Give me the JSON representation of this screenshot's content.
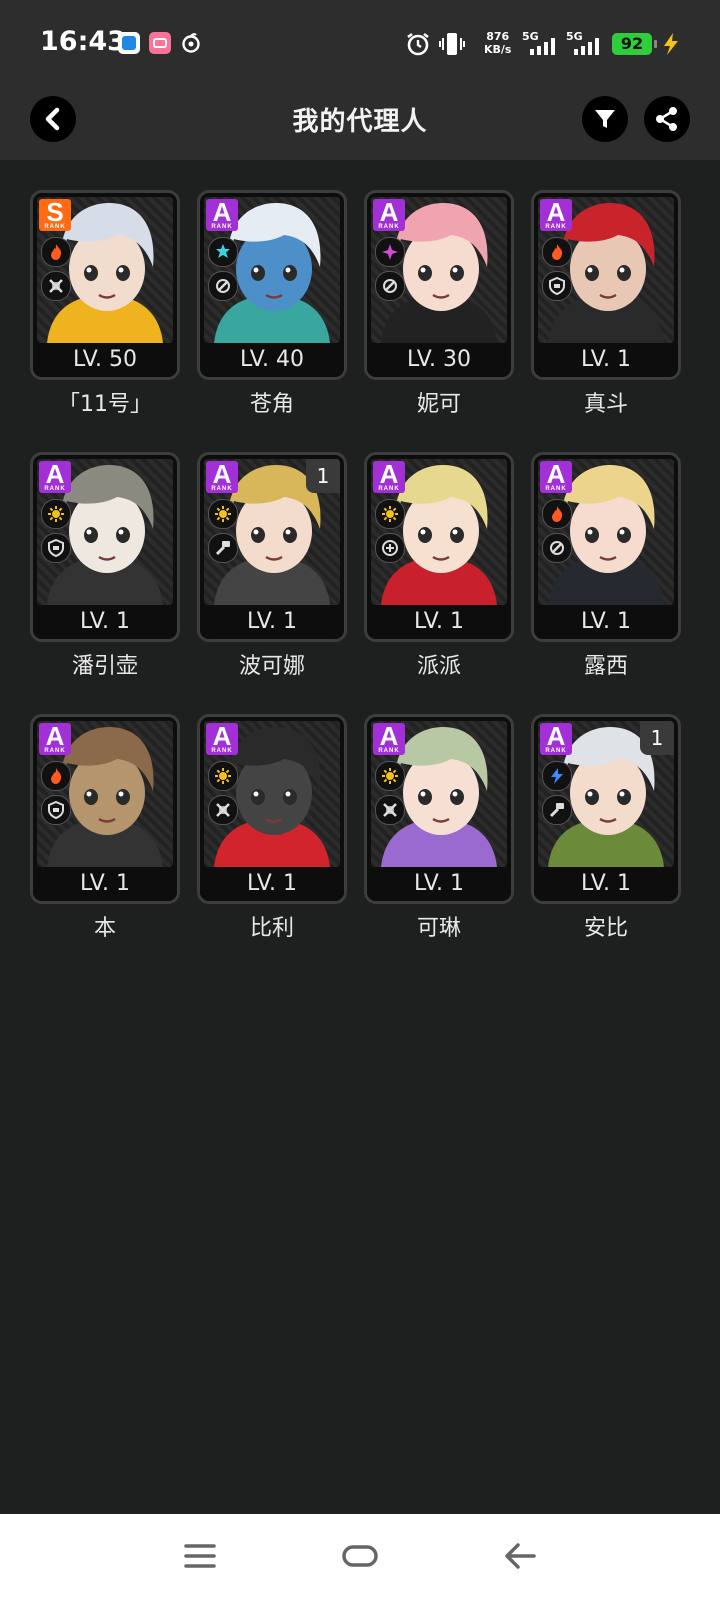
{
  "status_bar": {
    "time": "16:43",
    "net_speed_value": "876",
    "net_speed_unit": "KB/s",
    "signal_1": "5G",
    "signal_2": "5G",
    "battery": "92",
    "icons": [
      "app-icon-blue",
      "bilibili-icon",
      "netease-music-icon",
      "alarm-icon",
      "vibrate-icon",
      "charging-bolt-icon"
    ]
  },
  "header": {
    "title": "我的代理人",
    "back_icon": "chevron-left-icon",
    "filter_icon": "filter-funnel-icon",
    "share_icon": "share-icon"
  },
  "agents": [
    {
      "name": "「11号」",
      "level": "LV. 50",
      "rank": "S",
      "rank_sub": "RANK",
      "attribute": "fire",
      "specialty": "attack",
      "dupe": "",
      "theme": {
        "hair": "#d6dde8",
        "skin": "#f2dccd",
        "accent": "#f0b320"
      }
    },
    {
      "name": "苍角",
      "level": "LV. 40",
      "rank": "A",
      "rank_sub": "RANK",
      "attribute": "ice",
      "specialty": "support",
      "dupe": "",
      "theme": {
        "hair": "#e6ecf4",
        "skin": "#4d8fc8",
        "accent": "#3aa6a0"
      }
    },
    {
      "name": "妮可",
      "level": "LV. 30",
      "rank": "A",
      "rank_sub": "RANK",
      "attribute": "ether",
      "specialty": "support",
      "dupe": "",
      "theme": {
        "hair": "#f0a4b0",
        "skin": "#f6dccf",
        "accent": "#222"
      }
    },
    {
      "name": "真斗",
      "level": "LV. 1",
      "rank": "A",
      "rank_sub": "RANK",
      "attribute": "fire",
      "specialty": "defense",
      "dupe": "",
      "theme": {
        "hair": "#c9242c",
        "skin": "#e8c8b4",
        "accent": "#2a2a2a"
      }
    },
    {
      "name": "潘引壶",
      "level": "LV. 1",
      "rank": "A",
      "rank_sub": "RANK",
      "attribute": "physical",
      "specialty": "defense",
      "dupe": "",
      "theme": {
        "hair": "#8a8a80",
        "skin": "#efe8e0",
        "accent": "#333"
      }
    },
    {
      "name": "波可娜",
      "level": "LV. 1",
      "rank": "A",
      "rank_sub": "RANK",
      "attribute": "physical",
      "specialty": "stun",
      "dupe": "1",
      "theme": {
        "hair": "#d8b65a",
        "skin": "#f4dccc",
        "accent": "#444"
      }
    },
    {
      "name": "派派",
      "level": "LV. 1",
      "rank": "A",
      "rank_sub": "RANK",
      "attribute": "physical",
      "specialty": "anomaly",
      "dupe": "",
      "theme": {
        "hair": "#e6d88e",
        "skin": "#f6e0d0",
        "accent": "#c8202c"
      }
    },
    {
      "name": "露西",
      "level": "LV. 1",
      "rank": "A",
      "rank_sub": "RANK",
      "attribute": "fire",
      "specialty": "support",
      "dupe": "",
      "theme": {
        "hair": "#ecd48c",
        "skin": "#f6dccf",
        "accent": "#262a30"
      }
    },
    {
      "name": "本",
      "level": "LV. 1",
      "rank": "A",
      "rank_sub": "RANK",
      "attribute": "fire",
      "specialty": "defense",
      "dupe": "",
      "theme": {
        "hair": "#8a6a4a",
        "skin": "#b5956e",
        "accent": "#333"
      }
    },
    {
      "name": "比利",
      "level": "LV. 1",
      "rank": "A",
      "rank_sub": "RANK",
      "attribute": "physical",
      "specialty": "attack",
      "dupe": "",
      "theme": {
        "hair": "#2a2a2a",
        "skin": "#444",
        "accent": "#d2242c"
      }
    },
    {
      "name": "可琳",
      "level": "LV. 1",
      "rank": "A",
      "rank_sub": "RANK",
      "attribute": "physical",
      "specialty": "attack",
      "dupe": "",
      "theme": {
        "hair": "#b8c8a4",
        "skin": "#f6e0d4",
        "accent": "#9a6ad0"
      }
    },
    {
      "name": "安比",
      "level": "LV. 1",
      "rank": "A",
      "rank_sub": "RANK",
      "attribute": "electric",
      "specialty": "stun",
      "dupe": "1",
      "theme": {
        "hair": "#dfe2e6",
        "skin": "#f4dccc",
        "accent": "#6b8a3a"
      }
    }
  ],
  "attribute_colors": {
    "fire": "#ff5a1f",
    "ice": "#38d6e8",
    "ether": "#d24bd8",
    "physical": "#f2c21a",
    "electric": "#3a8cff"
  },
  "nav_bar": {
    "icons": [
      "menu-icon",
      "home-icon",
      "back-icon"
    ]
  }
}
